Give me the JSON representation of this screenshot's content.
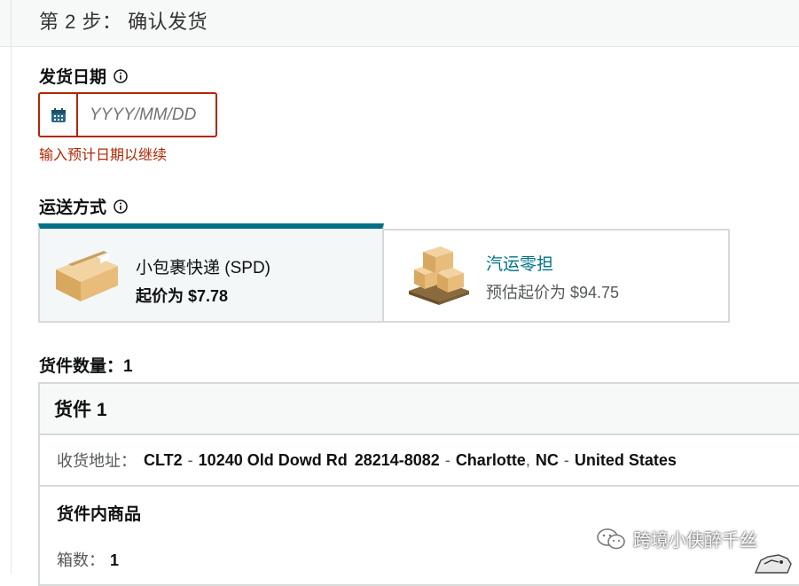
{
  "step": {
    "title": "第 2 步： 确认发货"
  },
  "ship_date": {
    "label": "发货日期",
    "placeholder": "YYYY/MM/DD",
    "value": "",
    "error": "输入预计日期以继续",
    "icons": {
      "info": "info-circle-icon",
      "calendar": "calendar-icon"
    }
  },
  "shipping_method": {
    "label": "运送方式",
    "options": [
      {
        "name": "小包裹快递 (SPD)",
        "price": "起价为 $7.78",
        "selected": true,
        "image": "single-box-icon"
      },
      {
        "name": "汽运零担",
        "price": "预估起价为 $94.75",
        "selected": false,
        "image": "pallet-boxes-icon"
      }
    ]
  },
  "quantity": {
    "label": "货件数量：1"
  },
  "shipment": {
    "title": "货件 1",
    "address_label": "收货地址：",
    "address": {
      "code": "CLT2",
      "street": "10240 Old Dowd Rd",
      "zip": "28214-8082",
      "city": "Charlotte",
      "state": "NC",
      "country": "United States"
    },
    "items_title": "货件内商品",
    "box_label": "箱数：",
    "box_count": "1"
  },
  "watermark": {
    "text": "跨境小侠醉千丝"
  },
  "colors": {
    "accent": "#007185",
    "error": "#b12704",
    "border": "#d5d9d9"
  }
}
